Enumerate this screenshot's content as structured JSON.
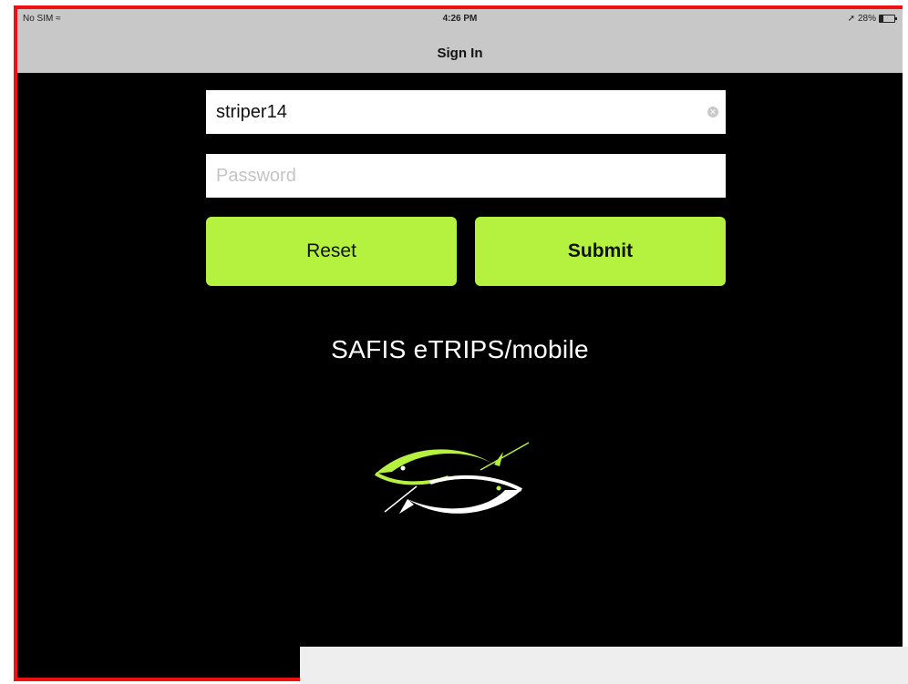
{
  "statusbar": {
    "carrier": "No SIM",
    "time": "4:26 PM",
    "battery": "28%"
  },
  "navbar": {
    "title": "Sign In"
  },
  "form": {
    "username_value": "striper14",
    "password_placeholder": "Password",
    "reset_label": "Reset",
    "submit_label": "Submit"
  },
  "branding": {
    "app_title": "SAFIS eTRIPS/mobile",
    "logo_icon": "twin-fish-logo"
  },
  "colors": {
    "accent": "#b5f23f",
    "background": "#000000",
    "bar": "#c8c8c8",
    "highlight_border": "#ee1111"
  }
}
